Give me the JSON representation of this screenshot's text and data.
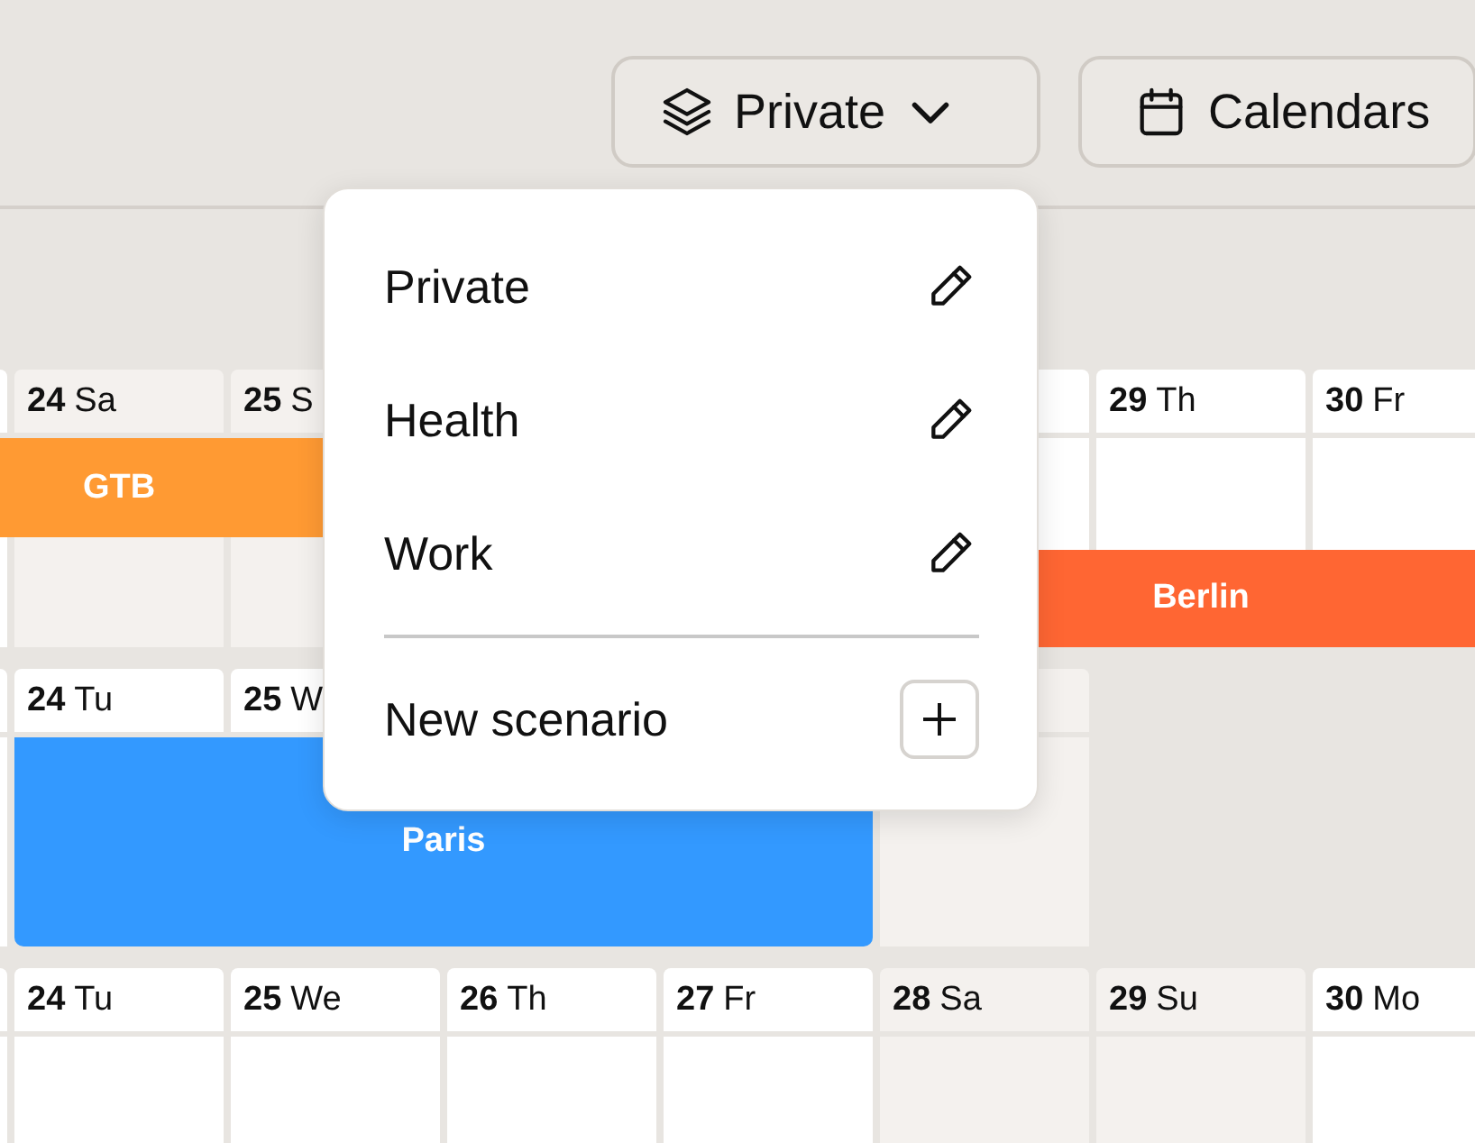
{
  "toolbar": {
    "scenario_button": {
      "label": "Private"
    },
    "calendars_button": {
      "label": "Calendars"
    }
  },
  "weeks": [
    {
      "days": [
        {
          "weekend": false
        },
        {
          "number": "24",
          "weekday": "Sa",
          "weekend": true
        },
        {
          "number": "25",
          "weekday": "S",
          "weekend": true
        },
        {
          "weekend": false
        },
        {
          "number": "29",
          "weekday": "Th",
          "weekend": false
        },
        {
          "number": "30",
          "weekday": "Fr",
          "weekend": false
        }
      ],
      "events": [
        {
          "title": "GTB",
          "color": "#ff9a33"
        },
        {
          "title": "Berlin",
          "color": "#ff6633"
        }
      ]
    },
    {
      "days": [
        {
          "weekend": false
        },
        {
          "number": "24",
          "weekday": "Tu",
          "weekend": false
        },
        {
          "number": "25",
          "weekday": "W",
          "weekend": false
        },
        {
          "weekend": true
        }
      ],
      "events": [
        {
          "title": "Paris",
          "color": "#3399ff"
        }
      ]
    },
    {
      "days": [
        {
          "weekend": false
        },
        {
          "number": "24",
          "weekday": "Tu",
          "weekend": false
        },
        {
          "number": "25",
          "weekday": "We",
          "weekend": false
        },
        {
          "number": "26",
          "weekday": "Th",
          "weekend": false
        },
        {
          "number": "27",
          "weekday": "Fr",
          "weekend": false
        },
        {
          "number": "28",
          "weekday": "Sa",
          "weekend": true
        },
        {
          "number": "29",
          "weekday": "Su",
          "weekend": true
        },
        {
          "number": "30",
          "weekday": "Mo",
          "weekend": false
        }
      ]
    }
  ],
  "scenario_menu": {
    "items": [
      {
        "label": "Private"
      },
      {
        "label": "Health"
      },
      {
        "label": "Work"
      }
    ],
    "new_item": {
      "label": "New scenario"
    }
  }
}
